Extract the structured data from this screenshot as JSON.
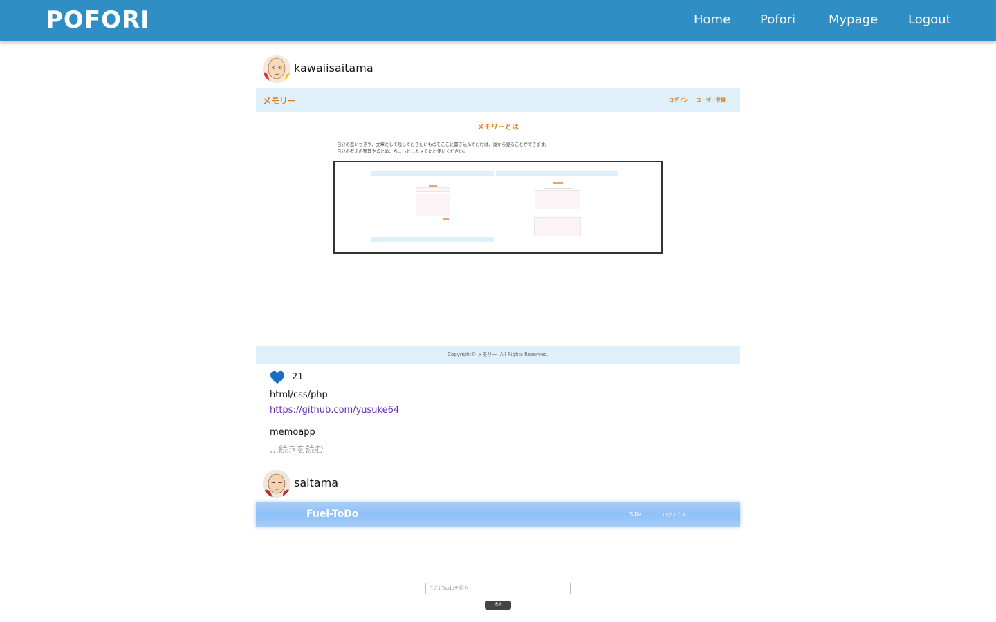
{
  "navbar": {
    "brand": "POFORI",
    "links": [
      "Home",
      "Pofori",
      "Mypage",
      "Logout"
    ]
  },
  "posts": [
    {
      "username": "kawaiisaitama",
      "preview": {
        "logo": "メモリー",
        "nav": [
          "ログイン",
          "ユーザー登録"
        ],
        "heading": "メモリーとは",
        "description": [
          "自分の思いつきや、文章として残しておきたいものをここに書き込んでおけば、後から見ることができます。",
          "自分の考えの整理やまとめ、ちょっとしたメモにお使いください。"
        ],
        "footer": "Copyright© メモリー .All Rights Reserved."
      },
      "likes": "21",
      "tech": "html/css/php",
      "url": "https://github.com/yusuke64",
      "title": "memoapp",
      "read_more": "…続きを読む"
    },
    {
      "username": "saitama",
      "preview": {
        "logo": "Fuel-ToDo",
        "nav": [
          "ToDo",
          "ログアウト"
        ],
        "input_placeholder": "ここにtodoを記入",
        "button": "追加"
      }
    }
  ],
  "colors": {
    "navbar": "#2f8ec4",
    "heart": "#1a6fc0",
    "link": "#6a2fb0",
    "accent_orange": "#e07b12"
  },
  "icons": {
    "like": "heart-icon"
  }
}
